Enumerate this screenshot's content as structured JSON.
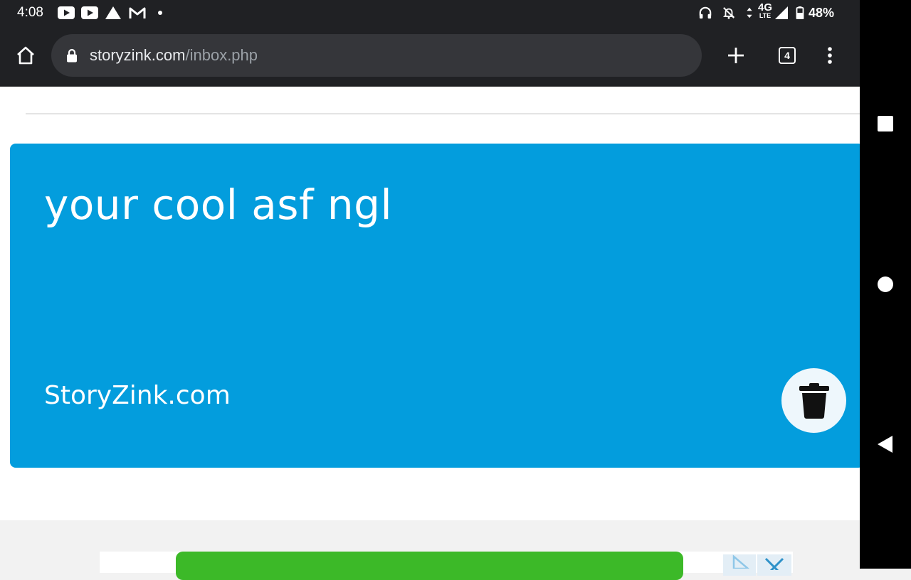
{
  "status_bar": {
    "time": "4:08",
    "battery_percent": "48%",
    "network_label": "4G",
    "network_sublabel": "LTE",
    "notification_icons": [
      "youtube-icon",
      "youtube-icon",
      "drive-icon",
      "gmail-icon",
      "dot-icon"
    ],
    "system_icons": [
      "headphones-icon",
      "bell-off-icon",
      "data-arrows-icon",
      "signal-icon",
      "battery-icon"
    ]
  },
  "toolbar": {
    "url_host": "storyzink.com",
    "url_path": "/inbox.php",
    "tab_count": "4",
    "icons": [
      "home-icon",
      "lock-icon",
      "plus-icon",
      "tabs-icon",
      "more-vert-icon"
    ]
  },
  "message_card": {
    "message": "your cool asf ngl",
    "brand": "StoryZink.com",
    "card_color": "#039ddd",
    "delete_icon": "trash-icon"
  },
  "nav_bar": {
    "icons": [
      "recents-icon",
      "home-circle-icon",
      "back-icon"
    ]
  }
}
